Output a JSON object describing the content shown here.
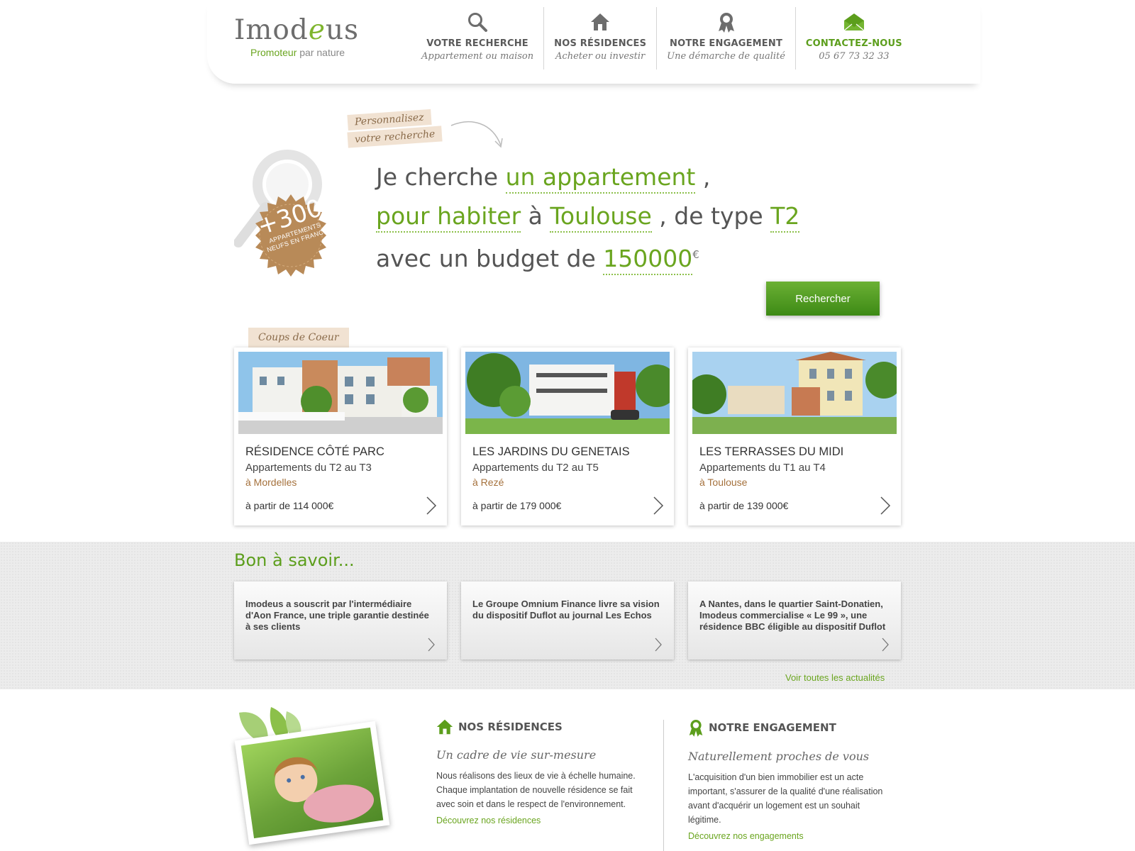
{
  "logo": {
    "wordmark_pre": "Imod",
    "wordmark_leaf": "e",
    "wordmark_post": "us",
    "tagline_green": "Promoteur",
    "tagline_rest": " par nature"
  },
  "nav": [
    {
      "title": "VOTRE RECHERCHE",
      "sub": "Appartement ou maison",
      "icon": "search-icon"
    },
    {
      "title": "NOS RÉSIDENCES",
      "sub": "Acheter ou investir",
      "icon": "house-icon"
    },
    {
      "title": "NOTRE ENGAGEMENT",
      "sub": "Une démarche de qualité",
      "icon": "award-ribbon-icon"
    },
    {
      "title": "CONTACTEZ-NOUS",
      "sub": "05 67 73 32 33",
      "icon": "envelope-icon"
    }
  ],
  "search": {
    "personalize_line1": "Personnalisez",
    "personalize_line2": "votre recherche",
    "seal_big": "+300",
    "seal_small": "APPARTEMENTS NEUFS EN FRANCE",
    "prefix1": "Je cherche",
    "field_type": "un appartement",
    "comma1": " ,",
    "field_purpose": "pour habiter",
    "a_word": " à ",
    "field_city": "Toulouse",
    "de_type": " , de type ",
    "field_rooms": "T2",
    "budget_prefix": "avec un budget de ",
    "field_budget": "150000",
    "currency": "€",
    "button": "Rechercher"
  },
  "coups_de_coeur": {
    "tab": "Coups de Coeur",
    "cards": [
      {
        "title": "RÉSIDENCE CÔTÉ PARC",
        "type": "Appartements du T2 au T3",
        "city": "à Mordelles",
        "price": "à partir de 114 000€"
      },
      {
        "title": "LES JARDINS DU GENETAIS",
        "type": "Appartements du T2 au T5",
        "city": "à Rezé",
        "price": "à partir de 179 000€"
      },
      {
        "title": "LES TERRASSES DU MIDI",
        "type": "Appartements du T1 au T4",
        "city": "à Toulouse",
        "price": "à partir de 139 000€"
      }
    ]
  },
  "bon_a_savoir": {
    "title": "Bon à savoir...",
    "news": [
      "Imodeus a souscrit par l'intermédiaire d'Aon France, une triple garantie destinée à ses clients",
      "Le Groupe Omnium Finance livre sa vision du dispositif Duflot au journal Les Echos",
      "A Nantes, dans le quartier Saint-Donatien, Imodeus commercialise « Le 99 », une résidence BBC éligible au dispositif Duflot"
    ],
    "all_link": "Voir toutes les actualités"
  },
  "footer": {
    "residences": {
      "title": "NOS RÉSIDENCES",
      "sub": "Un cadre de vie sur-mesure",
      "text": "Nous réalisons des lieux de vie à échelle humaine. Chaque implantation de nouvelle résidence se fait avec soin et dans le respect de l'environnement.",
      "link": "Découvrez nos résidences"
    },
    "engagement": {
      "title": "NOTRE ENGAGEMENT",
      "sub": "Naturellement proches de vous",
      "text": "L'acquisition d'un bien immobilier est un acte important, s'assurer de la qualité d'une réalisation avant d'acquérir un logement est un souhait légitime.",
      "link": "Découvrez nos engagements"
    }
  },
  "colors": {
    "green": "#6aa51f",
    "brown": "#a5713c",
    "tag_bg": "#f1e2d2"
  }
}
